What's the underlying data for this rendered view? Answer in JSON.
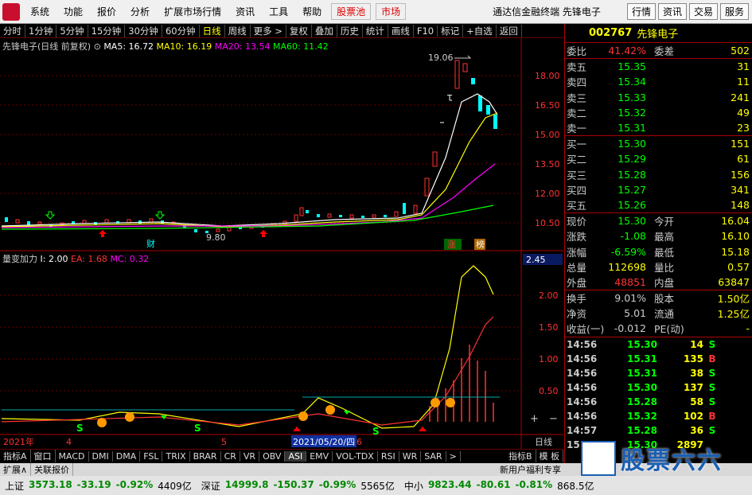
{
  "menu": {
    "items": [
      "系统",
      "功能",
      "报价",
      "分析",
      "扩展市场行情",
      "资讯",
      "工具",
      "帮助"
    ],
    "hot1": "股票池",
    "hot2": "市场",
    "title": "通达信金融终端  先锋电子",
    "right_buttons": [
      "行情",
      "资讯",
      "交易",
      "服务"
    ]
  },
  "toolbar": {
    "periods": [
      "分时",
      "1分钟",
      "5分钟",
      "15分钟",
      "30分钟",
      "60分钟",
      "日线",
      "周线",
      "更多 >"
    ],
    "active": "日线",
    "tools": [
      "复权",
      "叠加",
      "历史",
      "统计",
      "画线",
      "F10",
      "标记",
      "+自选",
      "返回"
    ]
  },
  "chart_header": {
    "stock": "先锋电子(日线 前复权)",
    "ma5": "MA5: 16.72",
    "ma10": "MA10: 16.19",
    "ma20": "MA20: 13.54",
    "ma60": "MA60: 11.42",
    "colors": {
      "ma5": "#ffffff",
      "ma10": "#ffff00",
      "ma20": "#ff00ff",
      "ma60": "#00ff00"
    }
  },
  "price_axis": [
    "18.00",
    "16.50",
    "15.00",
    "13.50",
    "12.00",
    "10.50"
  ],
  "annotations": {
    "high": "19.06",
    "low": "9.80",
    "cai": "财",
    "limit": "涨",
    "rank": "榜"
  },
  "indicator_header": {
    "name": "量变加力",
    "i": "I: 2.00",
    "ea": "EA: 1.68",
    "mc": "MC: 0.32"
  },
  "indicator_axis": [
    "2.45",
    "2.00",
    "1.50",
    "1.00",
    "0.50"
  ],
  "date_axis": {
    "year": "2021年",
    "m4": "4",
    "m5": "5",
    "cursor_date": "2021/05/20/四",
    "m6": "6",
    "period": "日线"
  },
  "indicator_tabs": [
    "指标A",
    "窗口",
    "MACD",
    "DMI",
    "DMA",
    "FSL",
    "TRIX",
    "BRAR",
    "CR",
    "VR",
    "OBV",
    "ASI",
    "EMV",
    "VOL-TDX",
    "RSI",
    "WR",
    "SAR",
    ">",
    "指标B",
    "模 板"
  ],
  "info_tabs": [
    "扩展∧",
    "关联报价"
  ],
  "promo": "新用户福利专享",
  "quote": {
    "code": "002767",
    "name": "先锋电子",
    "weibi_label": "委比",
    "weibi": "41.42%",
    "weicha_label": "委差",
    "weicha": "502",
    "asks": [
      {
        "label": "卖五",
        "price": "15.35",
        "vol": "31"
      },
      {
        "label": "卖四",
        "price": "15.34",
        "vol": "11"
      },
      {
        "label": "卖三",
        "price": "15.33",
        "vol": "241"
      },
      {
        "label": "卖二",
        "price": "15.32",
        "vol": "49"
      },
      {
        "label": "卖一",
        "price": "15.31",
        "vol": "23"
      }
    ],
    "bids": [
      {
        "label": "买一",
        "price": "15.30",
        "vol": "151"
      },
      {
        "label": "买二",
        "price": "15.29",
        "vol": "61"
      },
      {
        "label": "买三",
        "price": "15.28",
        "vol": "156"
      },
      {
        "label": "买四",
        "price": "15.27",
        "vol": "341"
      },
      {
        "label": "买五",
        "price": "15.26",
        "vol": "148"
      }
    ],
    "stats": [
      {
        "l1": "现价",
        "v1": "15.30",
        "c1": "g",
        "l2": "今开",
        "v2": "16.04",
        "c2": "r"
      },
      {
        "l1": "涨跌",
        "v1": "-1.08",
        "c1": "g",
        "l2": "最高",
        "v2": "16.10",
        "c2": "r"
      },
      {
        "l1": "涨幅",
        "v1": "-6.59%",
        "c1": "g",
        "l2": "最低",
        "v2": "15.18",
        "c2": "g"
      },
      {
        "l1": "总量",
        "v1": "112698",
        "c1": "y",
        "l2": "量比",
        "v2": "0.57",
        "c2": "y"
      },
      {
        "l1": "外盘",
        "v1": "48851",
        "c1": "r",
        "l2": "内盘",
        "v2": "63847",
        "c2": "g"
      }
    ],
    "stats2": [
      {
        "l1": "换手",
        "v1": "9.01%",
        "l2": "股本",
        "v2": "1.50亿"
      },
      {
        "l1": "净资",
        "v1": "5.01",
        "l2": "流通",
        "v2": "1.25亿"
      },
      {
        "l1": "收益(一)",
        "v1": "-0.012",
        "l2": "PE(动)",
        "v2": "-"
      }
    ],
    "ticks": [
      {
        "t": "14:56",
        "p": "15.30",
        "v": "14",
        "s": "S"
      },
      {
        "t": "14:56",
        "p": "15.31",
        "v": "135",
        "s": "B"
      },
      {
        "t": "14:56",
        "p": "15.31",
        "v": "38",
        "s": "S"
      },
      {
        "t": "14:56",
        "p": "15.30",
        "v": "137",
        "s": "S"
      },
      {
        "t": "14:56",
        "p": "15.28",
        "v": "58",
        "s": "S"
      },
      {
        "t": "14:56",
        "p": "15.32",
        "v": "102",
        "s": "B"
      },
      {
        "t": "14:57",
        "p": "15.28",
        "v": "36",
        "s": "S"
      },
      {
        "t": "15:00",
        "p": "15.30",
        "v": "2897",
        "s": ""
      }
    ]
  },
  "status": [
    {
      "name": "上证",
      "val": "3573.18",
      "chg": "-33.19",
      "pct": "-0.92%",
      "amt": "4409亿"
    },
    {
      "name": "深证",
      "val": "14999.8",
      "chg": "-150.37",
      "pct": "-0.99%",
      "amt": "5565亿"
    },
    {
      "name": "中小",
      "val": "9823.44",
      "chg": "-80.61",
      "pct": "-0.81%",
      "amt": "868.5亿"
    }
  ],
  "watermark": "股票六六"
}
